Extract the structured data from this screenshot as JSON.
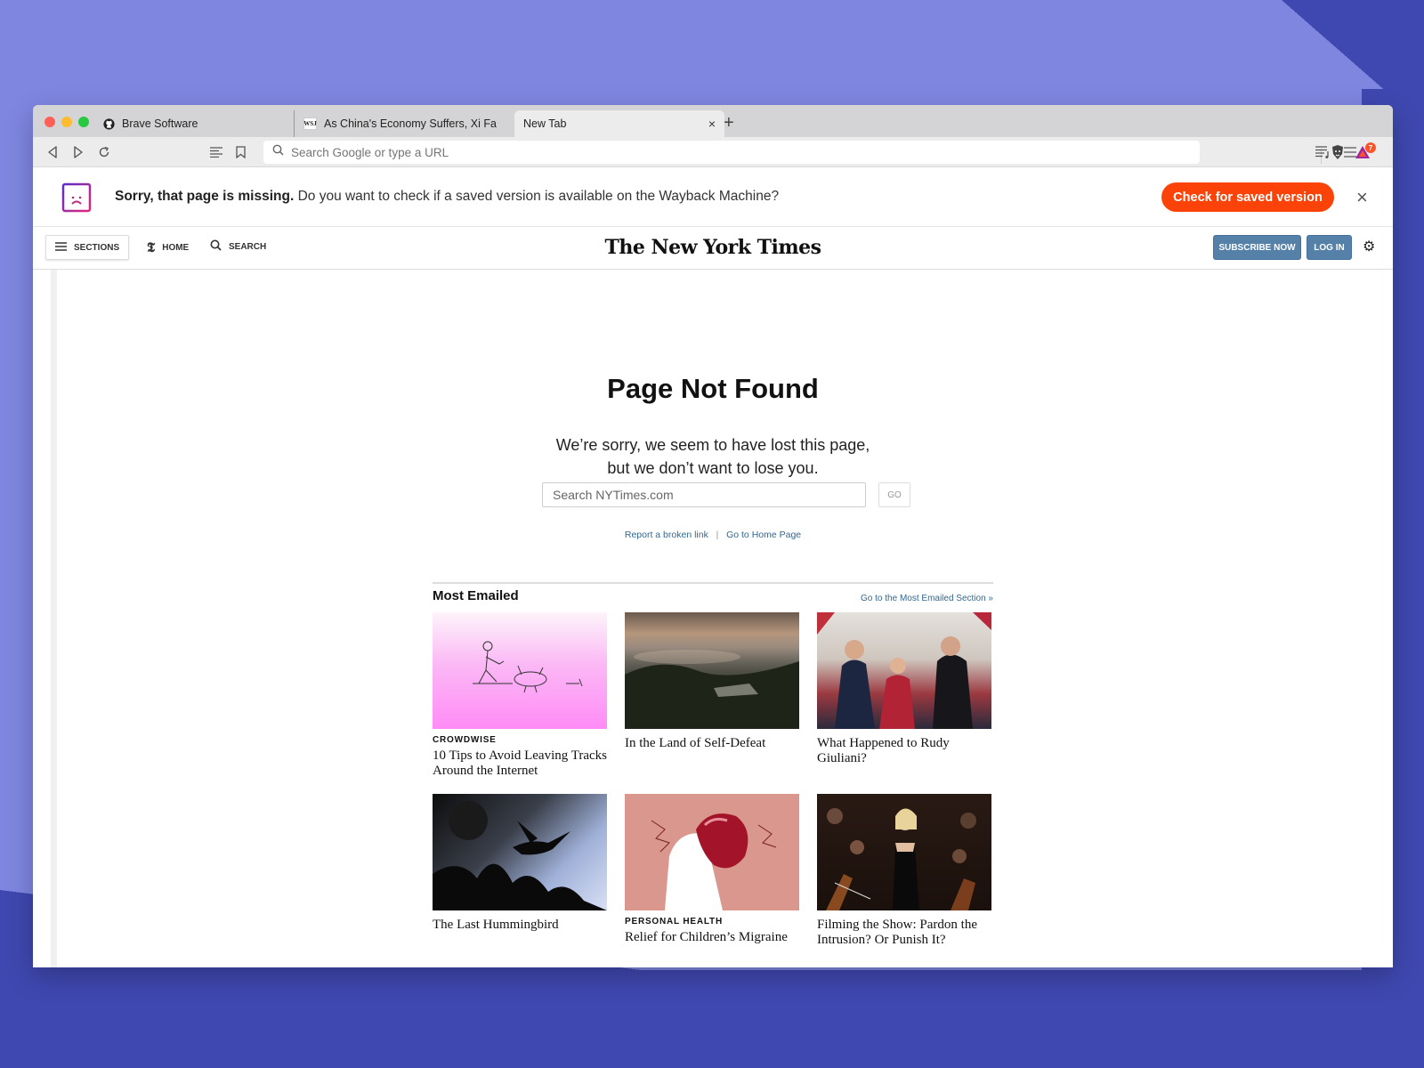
{
  "browser": {
    "tabs": [
      {
        "title": "Brave Software",
        "favicon": "github-icon",
        "active": false
      },
      {
        "title": "As China's Economy Suffers, Xi Fa",
        "favicon": "wsj-icon",
        "active": false
      },
      {
        "title": "New Tab",
        "favicon": "",
        "active": true
      }
    ],
    "wsj_favicon_text": "WSJ",
    "new_tab_symbol": "+",
    "close_symbol": "×",
    "url_placeholder": "Search Google or type a URL",
    "rewards_badge_count": "7"
  },
  "infobar": {
    "bold_text": "Sorry, that page is missing.",
    "text": " Do you want to check if a saved version is available on the Wayback Machine?",
    "button_label": "Check for saved version",
    "button_color": "#fb4309",
    "close_symbol": "×"
  },
  "nyt_header": {
    "sections_label": "SECTIONS",
    "home_label": "HOME",
    "search_label": "SEARCH",
    "logo_text": "The New York Times",
    "subscribe_label": "SUBSCRIBE NOW",
    "login_label": "LOG IN",
    "button_color": "#5580a8"
  },
  "not_found": {
    "title": "Page Not Found",
    "message_line1": "We’re sorry, we seem to have lost this page,",
    "message_line2": "but we don’t want to lose you.",
    "search_placeholder": "Search NYTimes.com",
    "go_label": "GO",
    "report_link": "Report a broken link",
    "separator": "|",
    "home_link": "Go to Home Page"
  },
  "most_emailed": {
    "title": "Most Emailed",
    "section_link": "Go to the Most Emailed Section »",
    "articles": [
      {
        "kicker": "CROWDWISE",
        "headline": "10 Tips to Avoid Leaving Tracks Around the Internet",
        "image": "pink-illustration-man-with-birds"
      },
      {
        "kicker": "",
        "headline": "In the Land of Self-Defeat",
        "image": "foggy-valley-landscape"
      },
      {
        "kicker": "",
        "headline": "What Happened to Rudy Giuliani?",
        "image": "giuliani-swearing-in-photo"
      },
      {
        "kicker": "",
        "headline": "The Last Hummingbird",
        "image": "hummingbird-silhouette"
      },
      {
        "kicker": "PERSONAL HEALTH",
        "headline": "Relief for Children’s Migraine",
        "image": "migraine-illustration"
      },
      {
        "kicker": "",
        "headline": "Filming the Show: Pardon the Intrusion? Or Punish It?",
        "image": "orchestra-performer-photo"
      }
    ]
  }
}
